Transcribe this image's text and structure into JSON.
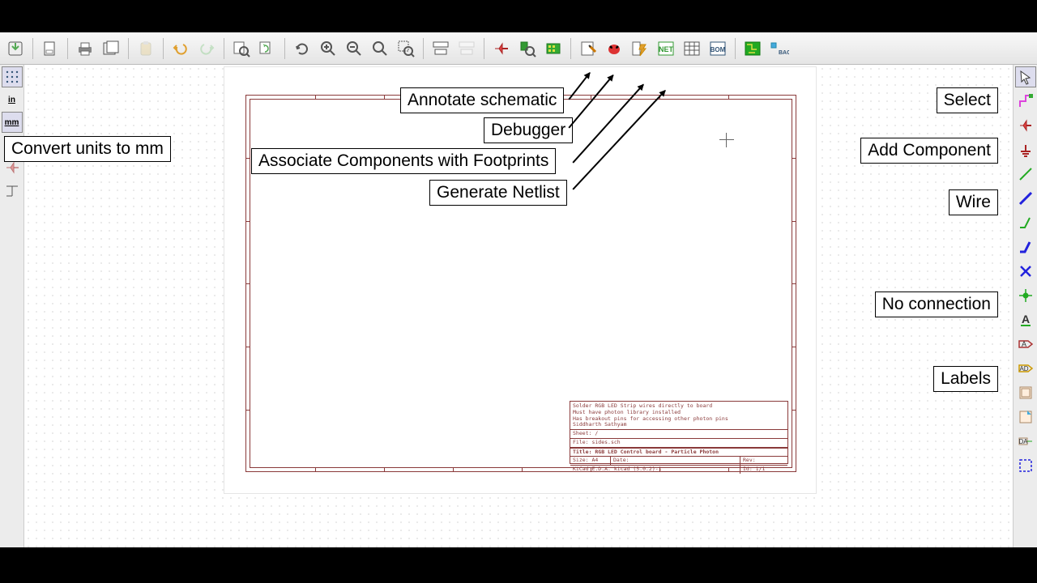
{
  "callouts": {
    "convert_mm": "Convert units to mm",
    "annotate": "Annotate schematic",
    "debugger": "Debugger",
    "associate": "Associate Components with Footprints",
    "netlist": "Generate Netlist",
    "select": "Select",
    "add_component": "Add Component",
    "wire": "Wire",
    "no_connection": "No connection",
    "labels": "Labels"
  },
  "left_toolbar": {
    "inch_unit": "in",
    "mm_unit": "mm"
  },
  "titleblock": {
    "notes_line1": "Solder RGB LED Strip wires directly to board",
    "notes_line2": "Must have photon library installed",
    "notes_line3": "Has breakout pins for accessing other photon pins",
    "notes_line4": "Siddharth Sathyam",
    "sheet": "Sheet: /",
    "file": "File: sides.sch",
    "title": "Title: RGB LED Control board - Particle Photon",
    "size": "Size: A4",
    "date": "Date:",
    "rev": "Rev:",
    "kicad": "KiCad E.D.A.  kicad (5.0.2)-1",
    "id": "Id: 1/1"
  },
  "toolbar_icons": {
    "back_label": "BACK"
  }
}
